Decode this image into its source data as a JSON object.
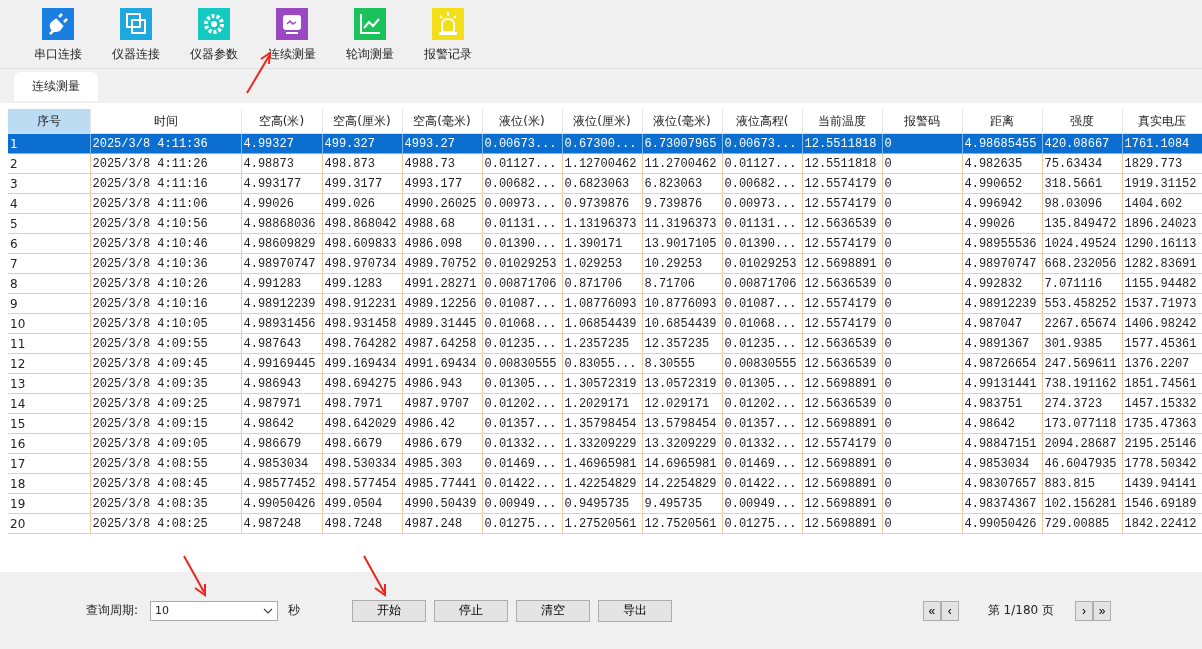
{
  "toolbar": {
    "items": [
      {
        "label": "串口连接"
      },
      {
        "label": "仪器连接"
      },
      {
        "label": "仪器参数"
      },
      {
        "label": "连续测量"
      },
      {
        "label": "轮询测量"
      },
      {
        "label": "报警记录"
      }
    ]
  },
  "tabs": [
    {
      "label": "连续测量",
      "selected": true
    }
  ],
  "table": {
    "columns": [
      "序号",
      "时间",
      "空高(米)",
      "空高(厘米)",
      "空高(毫米)",
      "液位(米)",
      "液位(厘米)",
      "液位(毫米)",
      "液位高程(",
      "当前温度",
      "报警码",
      "距离",
      "强度",
      "真实电压"
    ],
    "rows": [
      {
        "selected": true,
        "cells": [
          "1",
          "2025/3/8 4:11:36",
          "4.99327",
          "499.327",
          "4993.27",
          "0.00673...",
          "0.67300...",
          "6.73007965",
          "0.00673...",
          "12.5511818",
          "0",
          "4.98685455",
          "420.08667",
          "1761.1084"
        ]
      },
      {
        "selected": false,
        "cells": [
          "2",
          "2025/3/8 4:11:26",
          "4.98873",
          "498.873",
          "4988.73",
          "0.01127...",
          "1.12700462",
          "11.2700462",
          "0.01127...",
          "12.5511818",
          "0",
          "4.982635",
          "75.63434",
          "1829.773"
        ]
      },
      {
        "selected": false,
        "cells": [
          "3",
          "2025/3/8 4:11:16",
          "4.993177",
          "499.3177",
          "4993.177",
          "0.00682...",
          "0.6823063",
          "6.823063",
          "0.00682...",
          "12.5574179",
          "0",
          "4.990652",
          "318.5661",
          "1919.31152"
        ]
      },
      {
        "selected": false,
        "cells": [
          "4",
          "2025/3/8 4:11:06",
          "4.99026",
          "499.026",
          "4990.26025",
          "0.00973...",
          "0.9739876",
          "9.739876",
          "0.00973...",
          "12.5574179",
          "0",
          "4.996942",
          "98.03096",
          "1404.602"
        ]
      },
      {
        "selected": false,
        "cells": [
          "5",
          "2025/3/8 4:10:56",
          "4.98868036",
          "498.868042",
          "4988.68",
          "0.01131...",
          "1.13196373",
          "11.3196373",
          "0.01131...",
          "12.5636539",
          "0",
          "4.99026",
          "135.849472",
          "1896.24023"
        ]
      },
      {
        "selected": false,
        "cells": [
          "6",
          "2025/3/8 4:10:46",
          "4.98609829",
          "498.609833",
          "4986.098",
          "0.01390...",
          "1.390171",
          "13.9017105",
          "0.01390...",
          "12.5574179",
          "0",
          "4.98955536",
          "1024.49524",
          "1290.16113"
        ]
      },
      {
        "selected": false,
        "cells": [
          "7",
          "2025/3/8 4:10:36",
          "4.98970747",
          "498.970734",
          "4989.70752",
          "0.01029253",
          "1.029253",
          "10.29253",
          "0.01029253",
          "12.5698891",
          "0",
          "4.98970747",
          "668.232056",
          "1282.83691"
        ]
      },
      {
        "selected": false,
        "cells": [
          "8",
          "2025/3/8 4:10:26",
          "4.991283",
          "499.1283",
          "4991.28271",
          "0.00871706",
          "0.871706",
          "8.71706",
          "0.00871706",
          "12.5636539",
          "0",
          "4.992832",
          "7.071116",
          "1155.94482"
        ]
      },
      {
        "selected": false,
        "cells": [
          "9",
          "2025/3/8 4:10:16",
          "4.98912239",
          "498.912231",
          "4989.12256",
          "0.01087...",
          "1.08776093",
          "10.8776093",
          "0.01087...",
          "12.5574179",
          "0",
          "4.98912239",
          "553.458252",
          "1537.71973"
        ]
      },
      {
        "selected": false,
        "cells": [
          "10",
          "2025/3/8 4:10:05",
          "4.98931456",
          "498.931458",
          "4989.31445",
          "0.01068...",
          "1.06854439",
          "10.6854439",
          "0.01068...",
          "12.5574179",
          "0",
          "4.987047",
          "2267.65674",
          "1406.98242"
        ]
      },
      {
        "selected": false,
        "cells": [
          "11",
          "2025/3/8 4:09:55",
          "4.987643",
          "498.764282",
          "4987.64258",
          "0.01235...",
          "1.2357235",
          "12.357235",
          "0.01235...",
          "12.5636539",
          "0",
          "4.9891367",
          "301.9385",
          "1577.45361"
        ]
      },
      {
        "selected": false,
        "cells": [
          "12",
          "2025/3/8 4:09:45",
          "4.99169445",
          "499.169434",
          "4991.69434",
          "0.00830555",
          "0.83055...",
          "8.30555",
          "0.00830555",
          "12.5636539",
          "0",
          "4.98726654",
          "247.569611",
          "1376.2207"
        ]
      },
      {
        "selected": false,
        "cells": [
          "13",
          "2025/3/8 4:09:35",
          "4.986943",
          "498.694275",
          "4986.943",
          "0.01305...",
          "1.30572319",
          "13.0572319",
          "0.01305...",
          "12.5698891",
          "0",
          "4.99131441",
          "738.191162",
          "1851.74561"
        ]
      },
      {
        "selected": false,
        "cells": [
          "14",
          "2025/3/8 4:09:25",
          "4.987971",
          "498.7971",
          "4987.9707",
          "0.01202...",
          "1.2029171",
          "12.029171",
          "0.01202...",
          "12.5636539",
          "0",
          "4.983751",
          "274.3723",
          "1457.15332"
        ]
      },
      {
        "selected": false,
        "cells": [
          "15",
          "2025/3/8 4:09:15",
          "4.98642",
          "498.642029",
          "4986.42",
          "0.01357...",
          "1.35798454",
          "13.5798454",
          "0.01357...",
          "12.5698891",
          "0",
          "4.98642",
          "173.077118",
          "1735.47363"
        ]
      },
      {
        "selected": false,
        "cells": [
          "16",
          "2025/3/8 4:09:05",
          "4.986679",
          "498.6679",
          "4986.679",
          "0.01332...",
          "1.33209229",
          "13.3209229",
          "0.01332...",
          "12.5574179",
          "0",
          "4.98847151",
          "2094.28687",
          "2195.25146"
        ]
      },
      {
        "selected": false,
        "cells": [
          "17",
          "2025/3/8 4:08:55",
          "4.9853034",
          "498.530334",
          "4985.303",
          "0.01469...",
          "1.46965981",
          "14.6965981",
          "0.01469...",
          "12.5698891",
          "0",
          "4.9853034",
          "46.6047935",
          "1778.50342"
        ]
      },
      {
        "selected": false,
        "cells": [
          "18",
          "2025/3/8 4:08:45",
          "4.98577452",
          "498.577454",
          "4985.77441",
          "0.01422...",
          "1.42254829",
          "14.2254829",
          "0.01422...",
          "12.5698891",
          "0",
          "4.98307657",
          "883.815",
          "1439.94141"
        ]
      },
      {
        "selected": false,
        "cells": [
          "19",
          "2025/3/8 4:08:35",
          "4.99050426",
          "499.0504",
          "4990.50439",
          "0.00949...",
          "0.9495735",
          "9.495735",
          "0.00949...",
          "12.5698891",
          "0",
          "4.98374367",
          "102.156281",
          "1546.69189"
        ]
      },
      {
        "selected": false,
        "cells": [
          "20",
          "2025/3/8 4:08:25",
          "4.987248",
          "498.7248",
          "4987.248",
          "0.01275...",
          "1.27520561",
          "12.7520561",
          "0.01275...",
          "12.5698891",
          "0",
          "4.99050426",
          "729.00885",
          "1842.22412"
        ]
      }
    ]
  },
  "controls": {
    "period_label": "查询周期:",
    "period_value": "10",
    "unit": "秒",
    "buttons": [
      "开始",
      "停止",
      "清空",
      "导出"
    ]
  },
  "pager": {
    "first": "«",
    "prev": "‹",
    "page_text": "第 1/180 页",
    "next": "›",
    "last": "»"
  }
}
